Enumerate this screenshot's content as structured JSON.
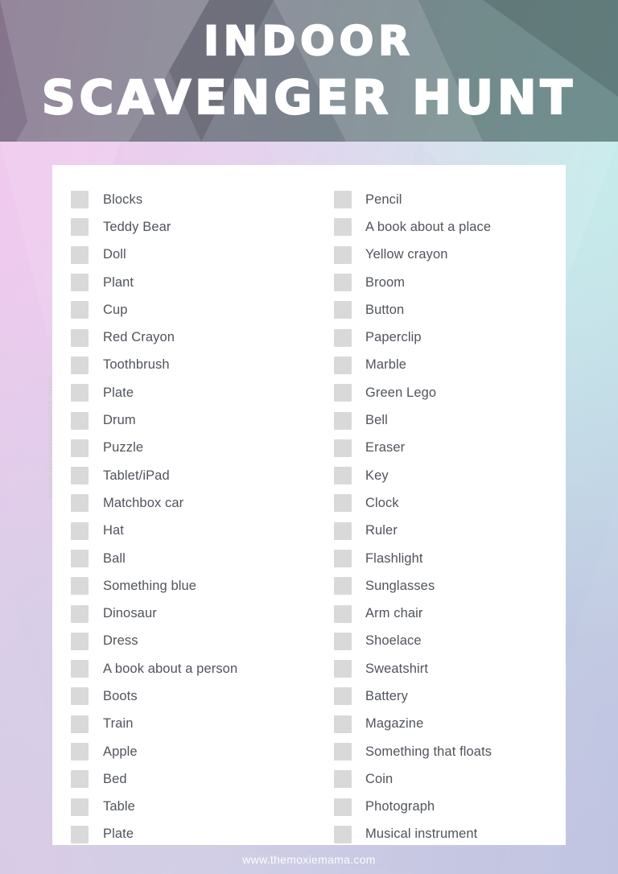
{
  "header": {
    "title_line_1": "Indoor",
    "title_line_2": "Scavenger Hunt",
    "background_gradient_from": "#85748c",
    "background_gradient_to": "#6f8f8f",
    "text_color": "#ffffff"
  },
  "page": {
    "background_corners": {
      "top_left": "#eec9ec",
      "top_right": "#c5edec",
      "bottom_left": "#d8c9e6",
      "bottom_right": "#bec2e0"
    },
    "card_background": "#ffffff",
    "checkbox_color": "#d9d9d9",
    "label_color": "#50545c"
  },
  "watermark": {
    "text": "www.themoxiemama.com",
    "color": "#cfcfcf"
  },
  "footer": {
    "url": "www.themoxiemama.com",
    "color": "#ffffff"
  },
  "checklist": {
    "left_column": [
      {
        "label": "Blocks",
        "checked": false
      },
      {
        "label": "Teddy Bear",
        "checked": false
      },
      {
        "label": "Doll",
        "checked": false
      },
      {
        "label": "Plant",
        "checked": false
      },
      {
        "label": "Cup",
        "checked": false
      },
      {
        "label": "Red Crayon",
        "checked": false
      },
      {
        "label": "Toothbrush",
        "checked": false
      },
      {
        "label": "Plate",
        "checked": false
      },
      {
        "label": "Drum",
        "checked": false
      },
      {
        "label": "Puzzle",
        "checked": false
      },
      {
        "label": "Tablet/iPad",
        "checked": false
      },
      {
        "label": "Matchbox car",
        "checked": false
      },
      {
        "label": "Hat",
        "checked": false
      },
      {
        "label": "Ball",
        "checked": false
      },
      {
        "label": "Something blue",
        "checked": false
      },
      {
        "label": "Dinosaur",
        "checked": false
      },
      {
        "label": "Dress",
        "checked": false
      },
      {
        "label": "A book about a person",
        "checked": false
      },
      {
        "label": "Boots",
        "checked": false
      },
      {
        "label": "Train",
        "checked": false
      },
      {
        "label": "Apple",
        "checked": false
      },
      {
        "label": "Bed",
        "checked": false
      },
      {
        "label": "Table",
        "checked": false
      },
      {
        "label": "Plate",
        "checked": false
      }
    ],
    "right_column": [
      {
        "label": "Pencil",
        "checked": false
      },
      {
        "label": "A book about a place",
        "checked": false
      },
      {
        "label": "Yellow crayon",
        "checked": false
      },
      {
        "label": "Broom",
        "checked": false
      },
      {
        "label": "Button",
        "checked": false
      },
      {
        "label": "Paperclip",
        "checked": false
      },
      {
        "label": "Marble",
        "checked": false
      },
      {
        "label": "Green Lego",
        "checked": false
      },
      {
        "label": "Bell",
        "checked": false
      },
      {
        "label": "Eraser",
        "checked": false
      },
      {
        "label": "Key",
        "checked": false
      },
      {
        "label": "Clock",
        "checked": false
      },
      {
        "label": "Ruler",
        "checked": false
      },
      {
        "label": "Flashlight",
        "checked": false
      },
      {
        "label": "Sunglasses",
        "checked": false
      },
      {
        "label": "Arm chair",
        "checked": false
      },
      {
        "label": "Shoelace",
        "checked": false
      },
      {
        "label": "Sweatshirt",
        "checked": false
      },
      {
        "label": "Battery",
        "checked": false
      },
      {
        "label": "Magazine",
        "checked": false
      },
      {
        "label": "Something that floats",
        "checked": false
      },
      {
        "label": "Coin",
        "checked": false
      },
      {
        "label": "Photograph",
        "checked": false
      },
      {
        "label": "Musical instrument",
        "checked": false
      }
    ]
  }
}
